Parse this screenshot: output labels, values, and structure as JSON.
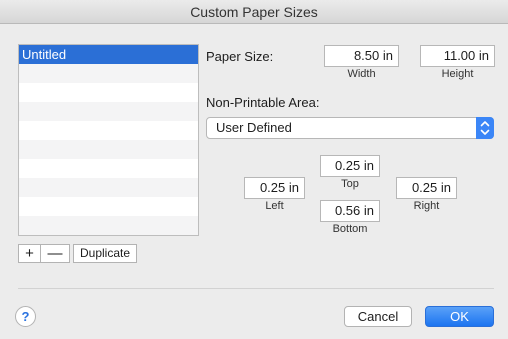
{
  "window": {
    "title": "Custom Paper Sizes"
  },
  "paper_list": {
    "items": [
      "Untitled",
      "",
      "",
      "",
      "",
      "",
      "",
      "",
      "",
      ""
    ],
    "selected_index": 0,
    "add_label": "+",
    "remove_label": "—",
    "duplicate_label": "Duplicate"
  },
  "paper_size": {
    "label": "Paper Size:",
    "width_value": "8.50 in",
    "width_caption": "Width",
    "height_value": "11.00 in",
    "height_caption": "Height"
  },
  "non_printable": {
    "label": "Non-Printable Area:",
    "selected_option": "User Defined",
    "top_value": "0.25 in",
    "top_caption": "Top",
    "left_value": "0.25 in",
    "left_caption": "Left",
    "right_value": "0.25 in",
    "right_caption": "Right",
    "bottom_value": "0.56 in",
    "bottom_caption": "Bottom"
  },
  "footer": {
    "help_label": "?",
    "cancel_label": "Cancel",
    "ok_label": "OK"
  },
  "colors": {
    "accent": "#2b6fd6",
    "ok_button": "#1c74f0"
  }
}
